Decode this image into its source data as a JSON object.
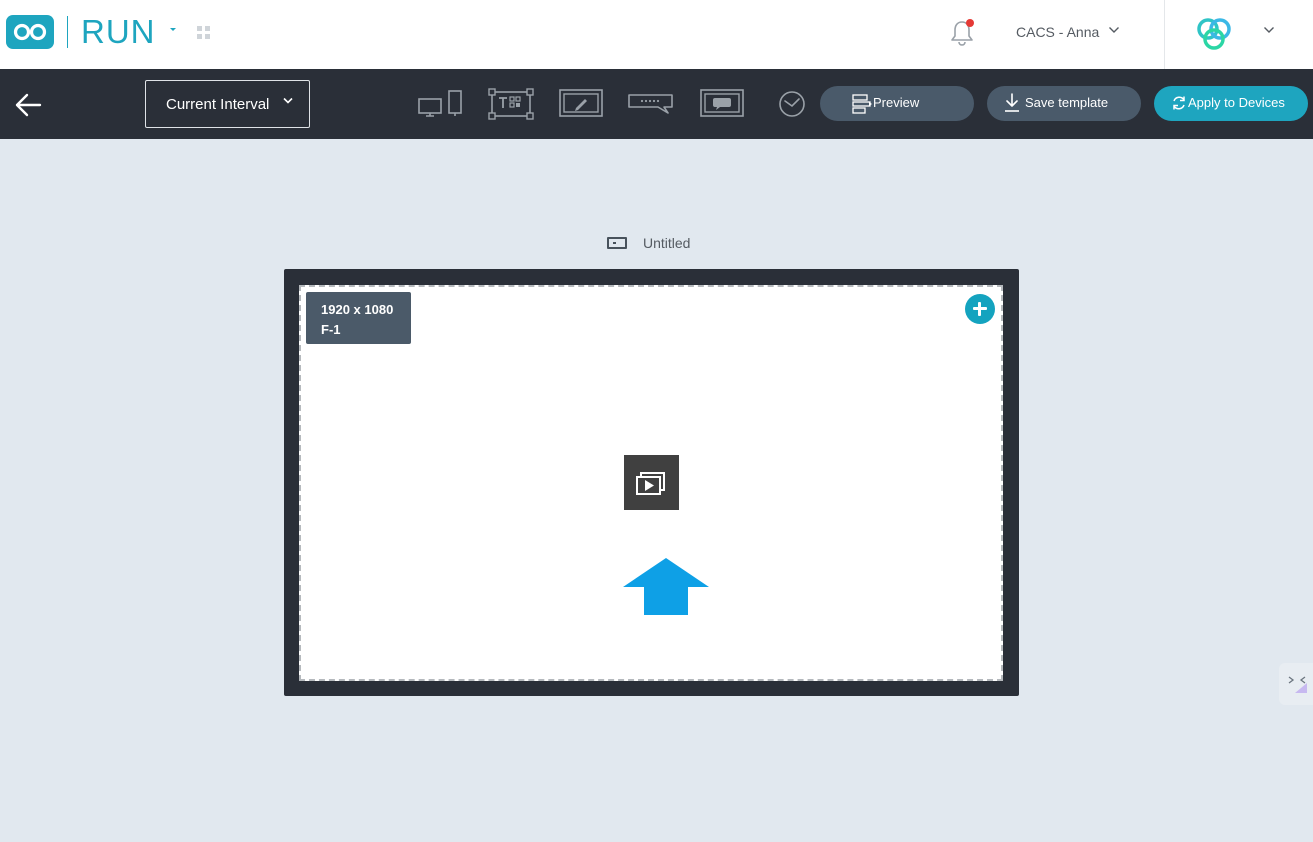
{
  "header": {
    "app_name": "RUN",
    "account_name": "CACS - Anna",
    "notification_unread": true
  },
  "toolbar": {
    "interval_label": "Current Interval",
    "tool_icons": [
      "screen-layout-icon",
      "text-qr-icon",
      "edit-frame-icon",
      "ticker-icon",
      "message-frame-icon",
      "clock-icon"
    ],
    "preview_label": "Preview",
    "save_template_label": "Save template",
    "apply_label": "Apply to Devices"
  },
  "canvas": {
    "template_name": "Untitled",
    "zone_resolution": "1920 x 1080",
    "zone_id": "F-1"
  },
  "colors": {
    "accent": "#1ea5bf",
    "toolbar_bg": "#2a2f38",
    "secondary_pill": "#4a5a6a",
    "canvas_bg": "#e1e8ef",
    "upload_arrow": "#0ea0e6",
    "notification_dot": "#e53935"
  }
}
